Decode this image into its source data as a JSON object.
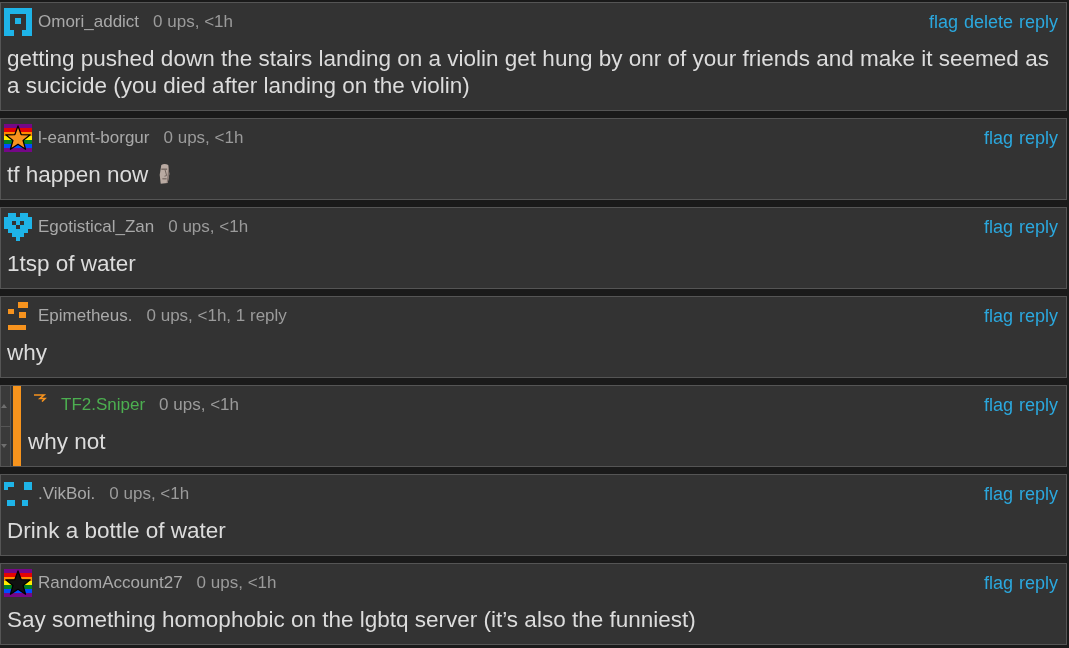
{
  "comments": [
    {
      "username": "Omori_addict",
      "highlighted": false,
      "meta": "0 ups, <1h",
      "avatar": {
        "kind": "frame",
        "color": "#1eb4e8"
      },
      "actions": [
        "flag",
        "delete",
        "reply"
      ],
      "body": "getting pushed down the stairs landing on a violin get hung by onr of your friends and make it seemed as a sucicide (you died after landing on the violin)",
      "emoji": false
    },
    {
      "username": "l-eanmt-borgur",
      "highlighted": false,
      "meta": "0 ups, <1h",
      "avatar": {
        "kind": "rainbow-star",
        "color": "#f7931e"
      },
      "actions": [
        "flag",
        "reply"
      ],
      "body": "tf happen now",
      "emoji": true
    },
    {
      "username": "Egotistical_Zan",
      "highlighted": false,
      "meta": "0 ups, <1h",
      "avatar": {
        "kind": "heart",
        "color": "#1eb4e8"
      },
      "actions": [
        "flag",
        "reply"
      ],
      "body": "1tsp of water",
      "emoji": false
    },
    {
      "username": "Epimetheus.",
      "highlighted": false,
      "meta": "0 ups, <1h, 1 reply",
      "avatar": {
        "kind": "blocks",
        "color": "#f7931e"
      },
      "actions": [
        "flag",
        "reply"
      ],
      "body": "why",
      "emoji": false,
      "children": [
        {
          "username": "TF2.Sniper",
          "highlighted": true,
          "meta": "0 ups, <1h",
          "avatar": {
            "kind": "zigzag",
            "color": "#f7931e"
          },
          "actions": [
            "flag",
            "reply"
          ],
          "body": "why not",
          "emoji": false
        }
      ]
    },
    {
      "username": ".VikBoi.",
      "highlighted": false,
      "meta": "0 ups, <1h",
      "avatar": {
        "kind": "corners",
        "color": "#1eb4e8"
      },
      "actions": [
        "flag",
        "reply"
      ],
      "body": "Drink a bottle of water",
      "emoji": false
    },
    {
      "username": "RandomAccount27",
      "highlighted": false,
      "meta": "0 ups, <1h",
      "avatar": {
        "kind": "rainbow-star",
        "color": "#111111"
      },
      "actions": [
        "flag",
        "reply"
      ],
      "body": "Say something homophobic on the lgbtq server (it’s also the funniest)",
      "emoji": false
    }
  ]
}
